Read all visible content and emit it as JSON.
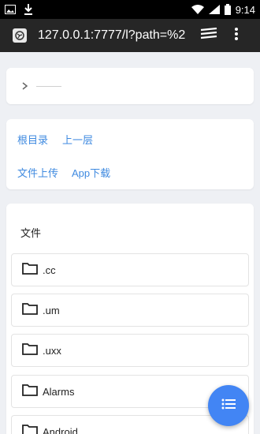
{
  "status_bar": {
    "time": "9:14",
    "icons": [
      "image-notification-icon",
      "download-icon",
      "wifi-icon",
      "signal-icon",
      "battery-icon"
    ]
  },
  "browser": {
    "url": "127.0.0.1:7777/l?path=%2",
    "icons": [
      "site-icon",
      "tabs-icon",
      "overflow-menu-icon"
    ]
  },
  "breadcrumb": {
    "icon": "chevron-right-icon"
  },
  "nav": {
    "root_label": "根目录",
    "up_label": "上一层",
    "upload_label": "文件上传",
    "app_download_label": "App下载"
  },
  "files": {
    "title": "文件",
    "items": [
      {
        "name": ".cc"
      },
      {
        "name": ".um"
      },
      {
        "name": ".uxx"
      },
      {
        "name": "Alarms"
      },
      {
        "name": "Android"
      }
    ]
  },
  "fab": {
    "icon": "list-icon"
  },
  "colors": {
    "accent": "#4285f4",
    "link": "#3f8ae0",
    "background": "#eef0f4"
  }
}
